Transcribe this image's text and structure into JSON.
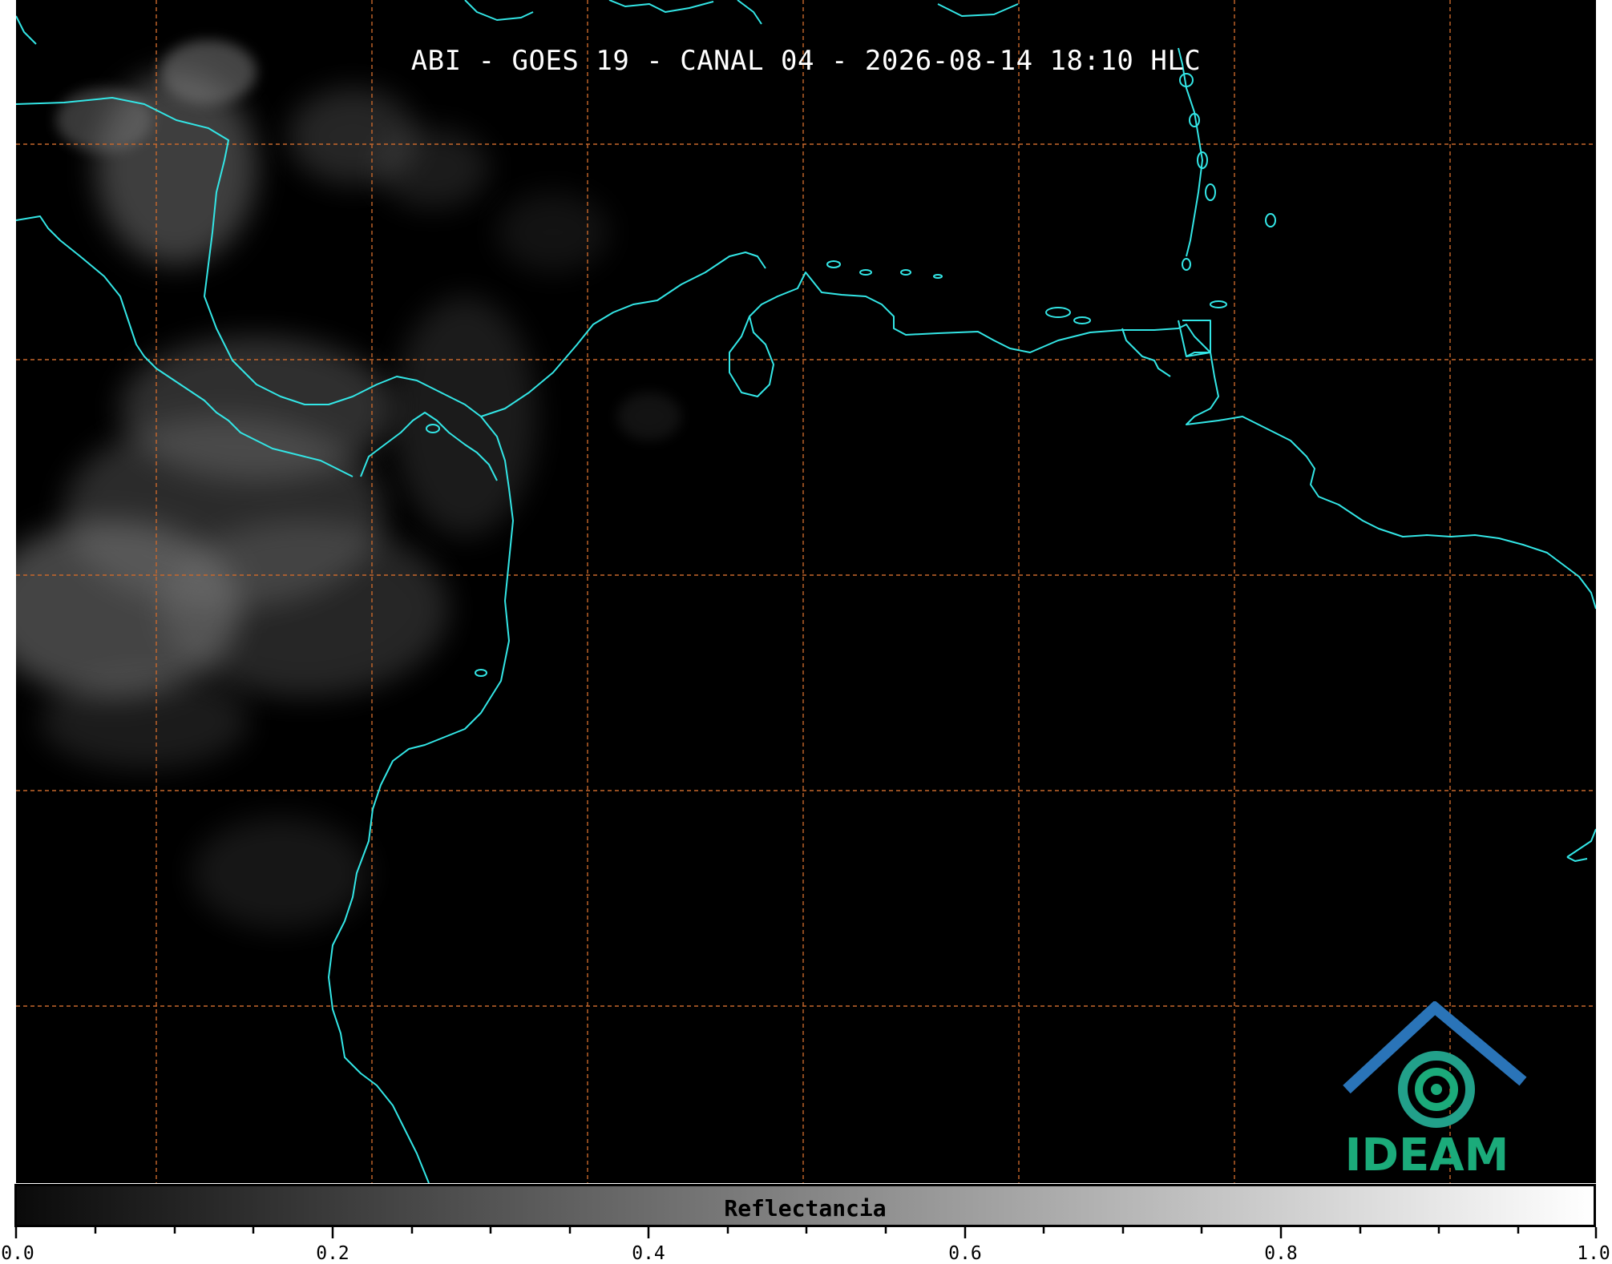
{
  "title": "ABI - GOES 19 - CANAL 04 - 2026-08-14 18:10 HLC",
  "colorbar": {
    "label": "Reflectancia",
    "range": [
      0.0,
      1.0
    ],
    "ticks": [
      "0.0",
      "0.2",
      "0.4",
      "0.6",
      "0.8",
      "1.0"
    ],
    "gradient": [
      "#0a0a0a",
      "#ffffff"
    ]
  },
  "logo": {
    "text": "IDEAM"
  },
  "colors": {
    "background": "#000000",
    "coastline": "#33e6e6",
    "gridline": "#c8682c",
    "cloud": "#8a8a8a",
    "logo_green": "#1bab7a",
    "logo_blue": "#2a74b8"
  }
}
